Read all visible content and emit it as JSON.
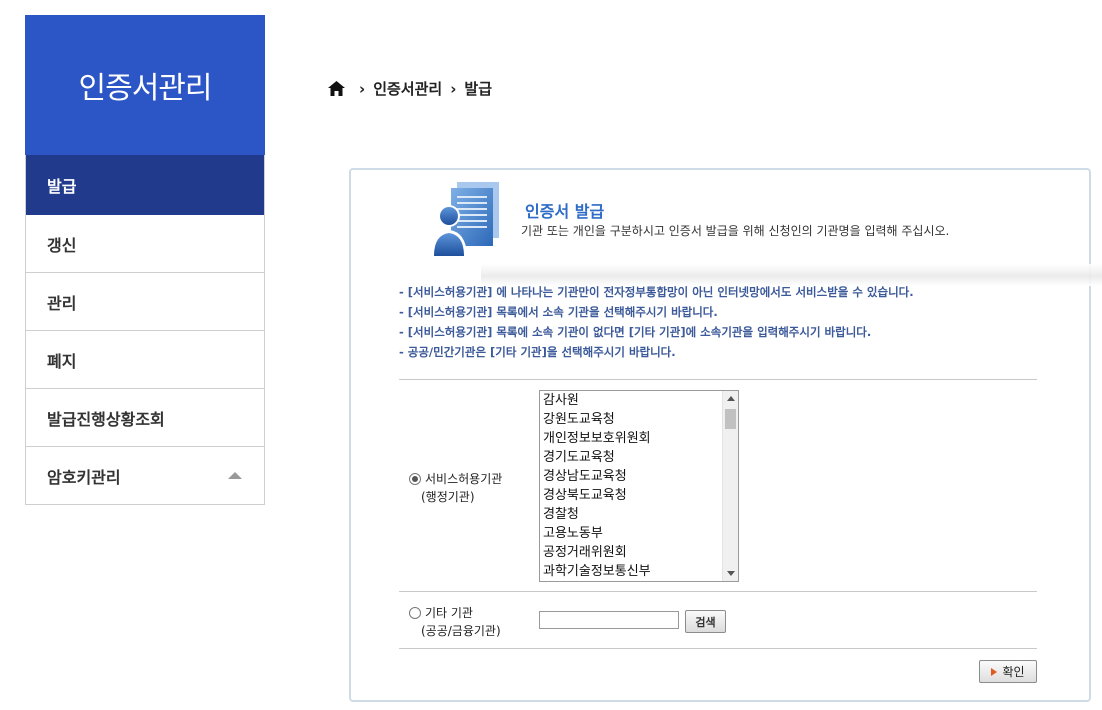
{
  "sidebar": {
    "title": "인증서관리",
    "items": [
      {
        "label": "발급"
      },
      {
        "label": "갱신"
      },
      {
        "label": "관리"
      },
      {
        "label": "폐지"
      },
      {
        "label": "발급진행상황조회"
      },
      {
        "label": "암호키관리"
      }
    ]
  },
  "breadcrumb": {
    "items": [
      "인증서관리",
      "발급"
    ]
  },
  "panel": {
    "title": "인증서 발급",
    "description": "기관 또는 개인을 구분하시고 인증서 발급을 위해 신청인의 기관명을 입력해 주십시오.",
    "notes": [
      "- [서비스허용기관] 에 나타나는 기관만이 전자정부통합망이 아닌 인터넷망에서도 서비스받을 수 있습니다.",
      "- [서비스허용기관] 목록에서 소속 기관을 선택해주시기 바랍니다.",
      "- [서비스허용기관] 목록에 소속 기관이 없다면 [기타 기관]에 소속기관을 입력해주시기 바랍니다.",
      "- 공공/민간기관은 [기타 기관]을 선택해주시기 바랍니다."
    ],
    "option1": {
      "label": "서비스허용기관",
      "sub": "(행정기관)"
    },
    "option2": {
      "label": "기타 기관",
      "sub": "(공공/금융기관)"
    },
    "agencies": [
      "감사원",
      "강원도교육청",
      "개인정보보호위원회",
      "경기도교육청",
      "경상남도교육청",
      "경상북도교육청",
      "경찰청",
      "고용노동부",
      "공정거래위원회",
      "과학기술정보통신부"
    ],
    "other_input_value": "",
    "search_label": "검색",
    "confirm_label": "확인"
  },
  "colors": {
    "sidebar_header": "#2c55c6",
    "sidebar_active": "#213a8c",
    "panel_title": "#2e6cc8",
    "notes": "#3c5a9a",
    "panel_border": "#cfdbe6"
  },
  "icons": {
    "home": "home-icon",
    "document_person": "document-person-icon",
    "play": "play-icon",
    "collapse": "triangle-up-icon"
  }
}
